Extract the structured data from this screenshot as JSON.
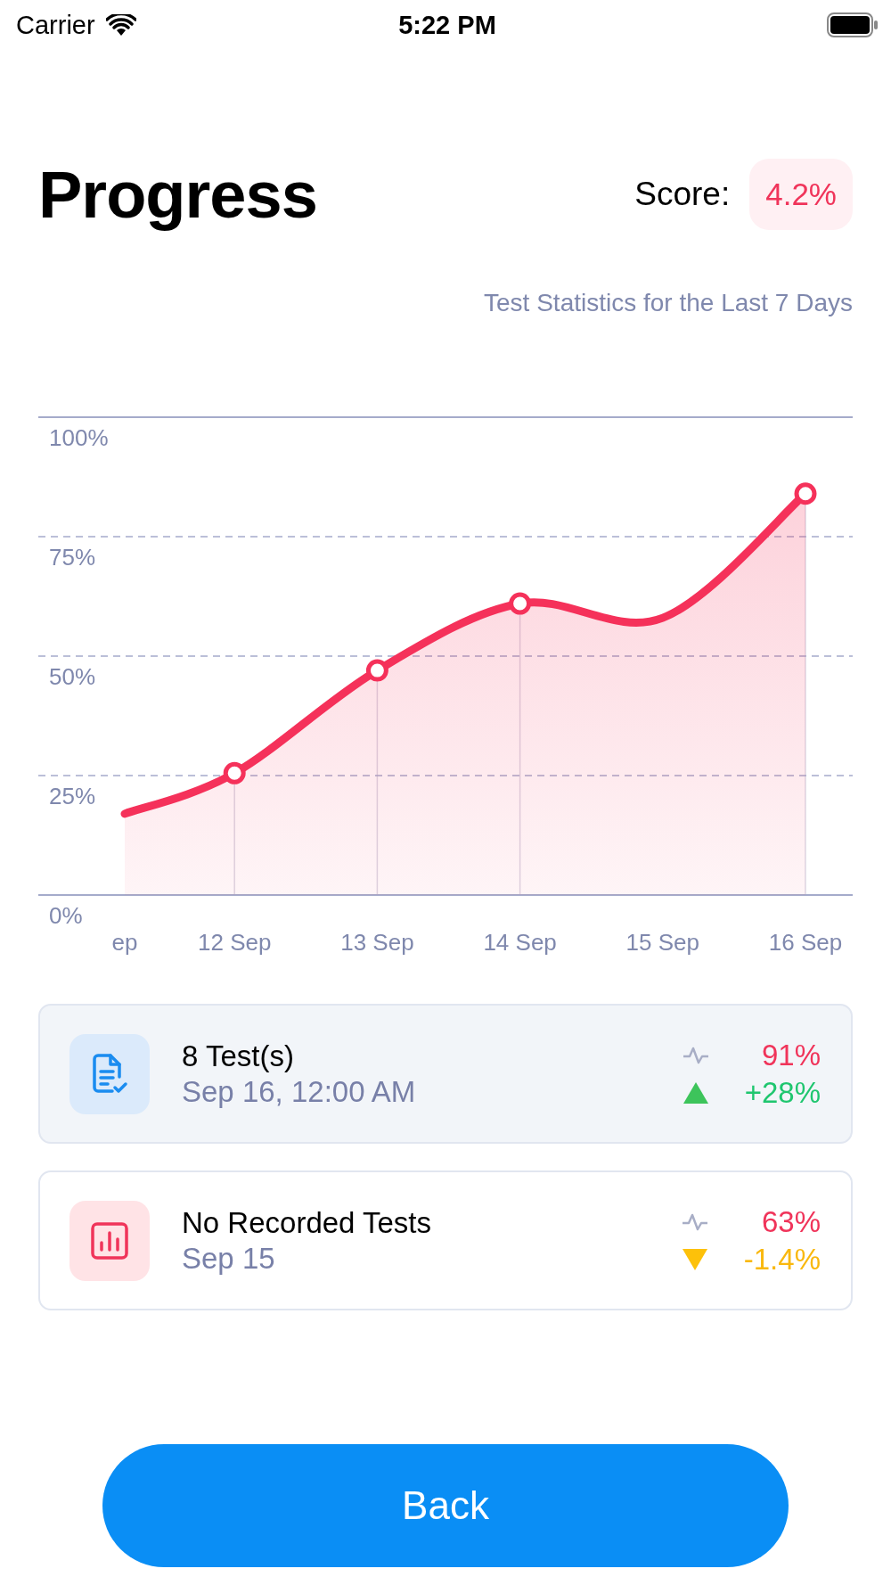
{
  "status_bar": {
    "carrier": "Carrier",
    "time": "5:22 PM"
  },
  "header": {
    "title": "Progress",
    "score_label": "Score:",
    "score_value": "4.2%"
  },
  "subtitle": "Test Statistics for the Last 7 Days",
  "chart_data": {
    "type": "area",
    "categories": [
      "ep",
      "12 Sep",
      "13 Sep",
      "14 Sep",
      "15 Sep",
      "16 Sep"
    ],
    "ylim": [
      0,
      100
    ],
    "yticks": [
      {
        "value": 0,
        "label": "0%"
      },
      {
        "value": 25,
        "label": "25%"
      },
      {
        "value": 50,
        "label": "50%"
      },
      {
        "value": 75,
        "label": "75%"
      },
      {
        "value": 100,
        "label": "100%"
      }
    ],
    "grid": true,
    "series": [
      {
        "color": "#f5315a",
        "values": [
          17,
          25.5,
          47,
          61,
          58,
          84
        ]
      }
    ]
  },
  "chart_point_markers": [
    false,
    true,
    true,
    true,
    false,
    true
  ],
  "cards": [
    {
      "kind": "tests",
      "selected": true,
      "title": "8 Test(s)",
      "date": "Sep 16, 12:00 AM",
      "score": "91%",
      "rising": true,
      "change": "+28%"
    },
    {
      "kind": "empty",
      "selected": false,
      "title": "No Recorded Tests",
      "date": "Sep 15",
      "score": "63%",
      "rising": false,
      "change": "-1.4%"
    }
  ],
  "back_button": "Back"
}
